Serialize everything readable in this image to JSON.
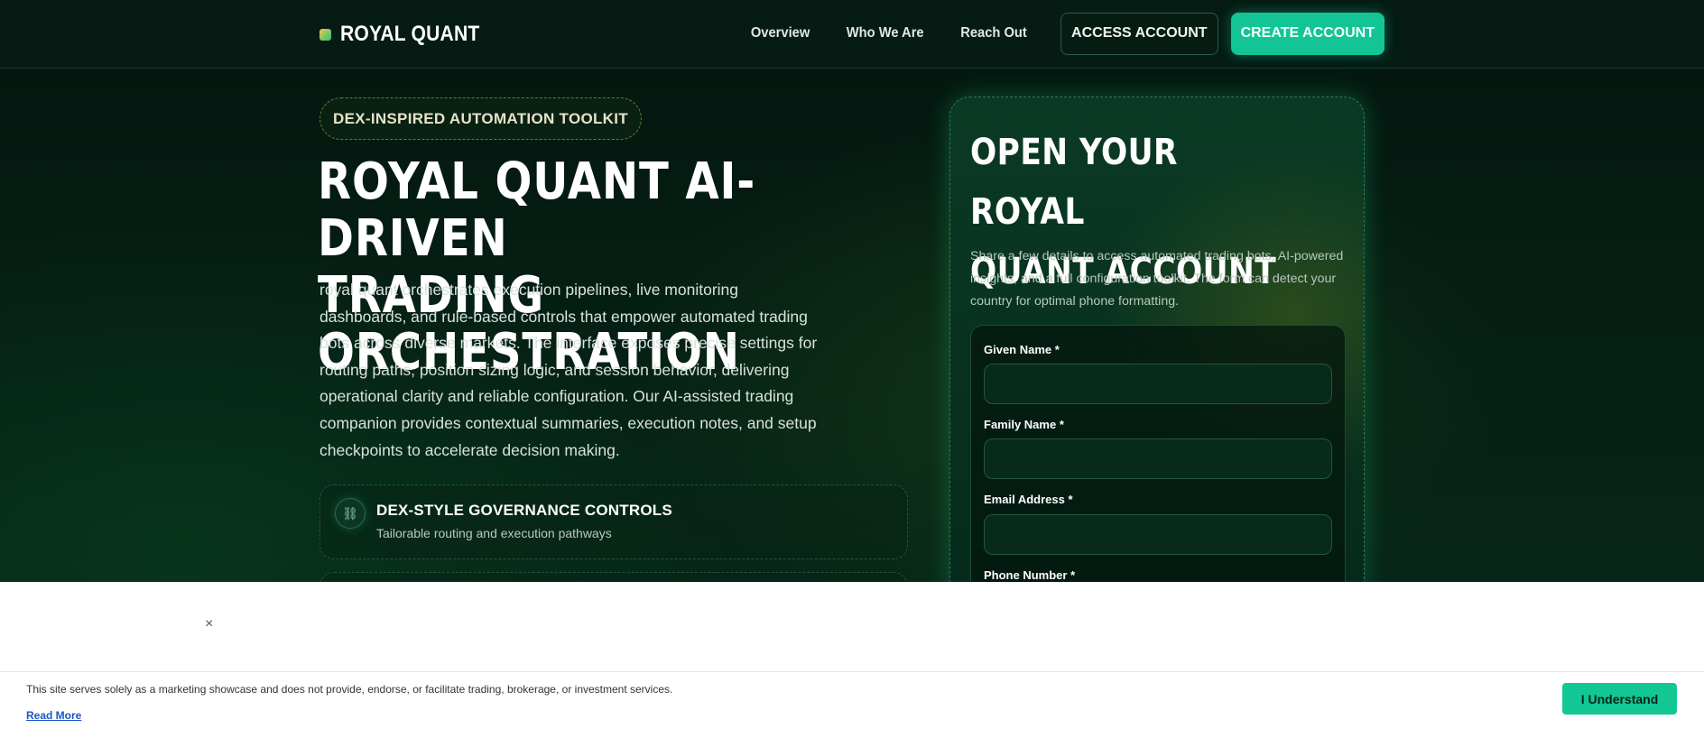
{
  "header": {
    "brand": "ROYAL QUANT",
    "nav": [
      "Overview",
      "Who We Are",
      "Reach Out"
    ],
    "login_label": "ACCESS ACCOUNT",
    "signup_label": "CREATE ACCOUNT"
  },
  "hero": {
    "pill": "DEX-INSPIRED AUTOMATION TOOLKIT",
    "title_line1": "ROYAL QUANT AI-DRIVEN",
    "title_line2": "TRADING ORCHESTRATION",
    "description": "royal quant orchestrates execution pipelines, live monitoring dashboards, and rule-based controls that empower automated trading bots across diverse markets. The interface exposes precise settings for routing paths, position sizing logic, and session behavior, delivering operational clarity and reliable configuration. Our AI-assisted trading companion provides contextual summaries, execution notes, and setup checkpoints to accelerate decision making.",
    "feature": {
      "icon": "link-icon",
      "glyph": "⛓",
      "title": "DEX-STYLE GOVERNANCE CONTROLS",
      "subtitle": "Tailorable routing and execution pathways"
    }
  },
  "form": {
    "title_line1": "OPEN YOUR ROYAL",
    "title_line2": "QUANT ACCOUNT",
    "description": "Share a few details to access automated trading bots, AI-powered insights, and a full configuration toolkit. The form can detect your country for optimal phone formatting.",
    "fields": [
      {
        "label": "Given Name *",
        "value": ""
      },
      {
        "label": "Family Name *",
        "value": ""
      },
      {
        "label": "Email Address *",
        "value": ""
      },
      {
        "label": "Phone Number *",
        "value": ""
      }
    ]
  },
  "cookie": {
    "close_glyph": "×",
    "text": "This site serves solely as a marketing showcase and does not provide, endorse, or facilitate trading, brokerage, or investment services.",
    "link": "Read More",
    "button": "I Understand"
  },
  "colors": {
    "accent": "#13c595",
    "background": "#04150f",
    "link": "#1a56c4"
  }
}
